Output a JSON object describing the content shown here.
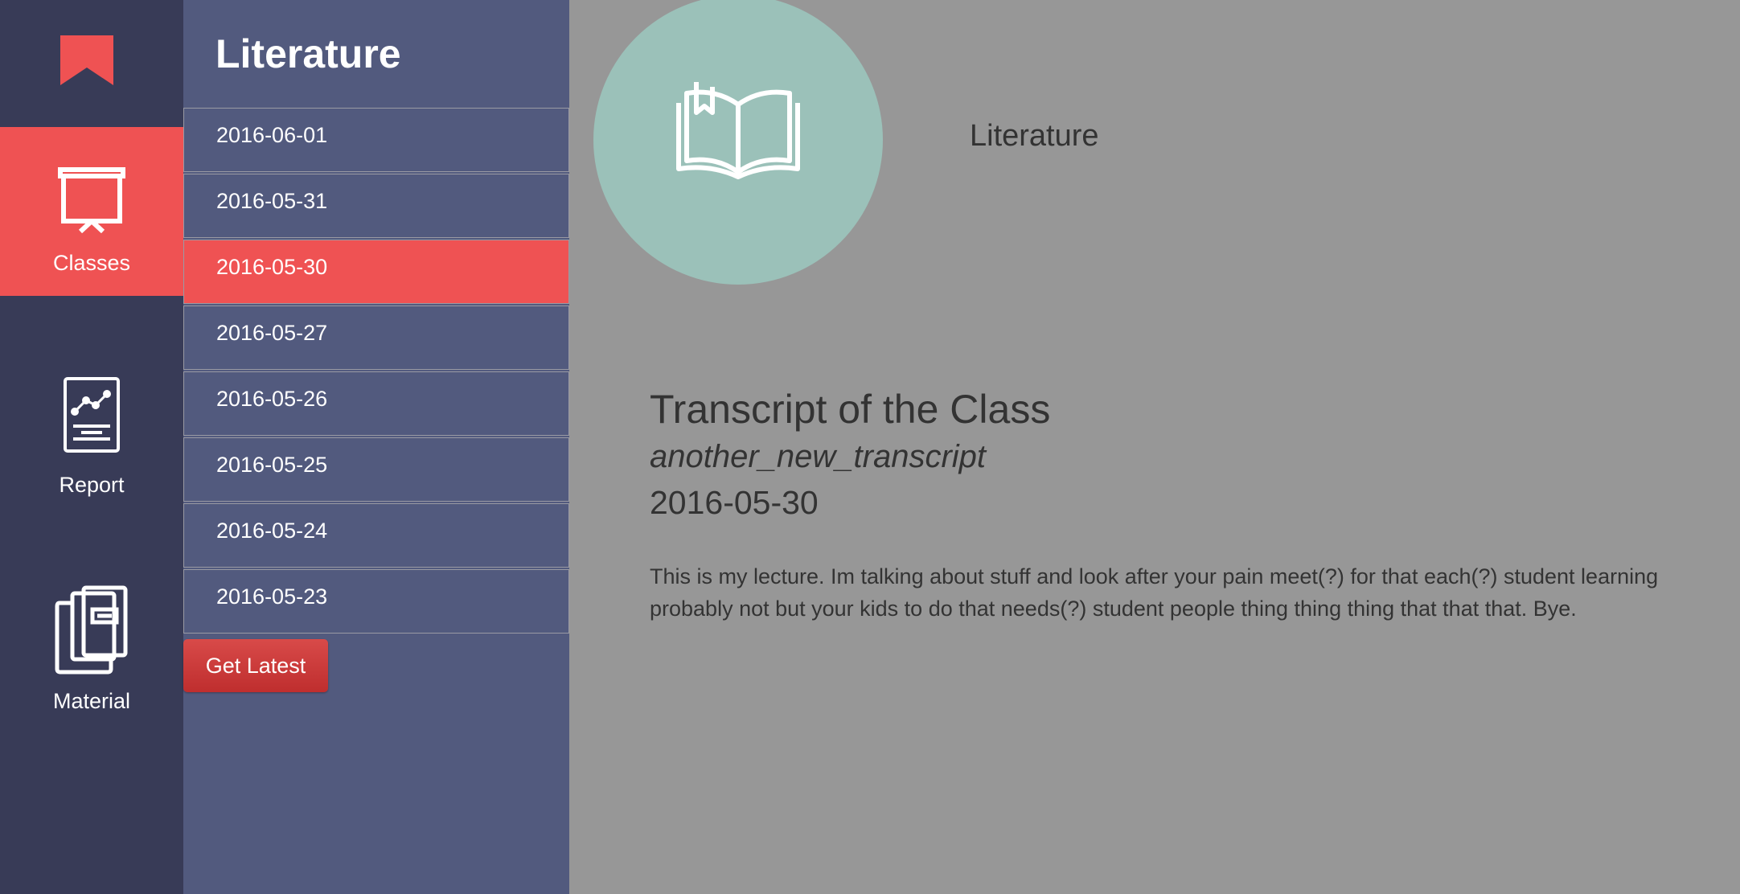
{
  "colors": {
    "rail_bg": "#383b57",
    "list_bg": "#525a7e",
    "accent": "#ef5253",
    "main_bg": "#979797",
    "avatar_bg": "#9bc1b9",
    "button": "#c83b3a"
  },
  "logo": {
    "icon": "bookmark-icon"
  },
  "rail": {
    "items": [
      {
        "label": "Classes",
        "icon": "presentation-board-icon",
        "active": true
      },
      {
        "label": "Report",
        "icon": "report-chart-icon",
        "active": false
      },
      {
        "label": "Material",
        "icon": "documents-stack-icon",
        "active": false
      }
    ]
  },
  "list": {
    "title": "Literature",
    "dates": [
      "2016-06-01",
      "2016-05-31",
      "2016-05-30",
      "2016-05-27",
      "2016-05-26",
      "2016-05-25",
      "2016-05-24",
      "2016-05-23"
    ],
    "selected_date": "2016-05-30",
    "get_latest_label": "Get Latest"
  },
  "main": {
    "avatar_icon": "open-book-icon",
    "class_name": "Literature",
    "transcript": {
      "heading": "Transcript of the Class",
      "name": "another_new_transcript",
      "date": "2016-05-30",
      "body": "This is my lecture. Im talking about stuff and look after your pain meet(?) for that each(?) student learning probably not but your kids to do that needs(?) student people thing thing thing that that that. Bye."
    }
  }
}
